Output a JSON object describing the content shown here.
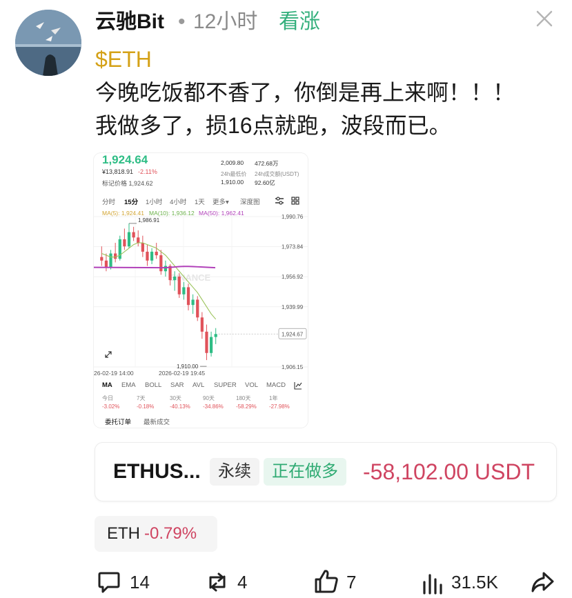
{
  "post": {
    "author": "云驰Bit",
    "dot": "•",
    "time": "12小时",
    "sentiment": "看涨",
    "tag": "$ETH",
    "text_line1": "今晚吃饭都不香了，你倒是再上来啊！！！",
    "text_line2": "我做多了，损16点就跑，波段而已。"
  },
  "chart_shot": {
    "price": "1,924.64",
    "sub_price": "¥13,818.91",
    "change": "-2.11%",
    "mark_label": "标记价格 1,924.62",
    "stat_top1": "2,009.80",
    "stat_top2": "472.68万",
    "stat_low_label": "24h最低价",
    "stat_vol_label": "24h成交额(USDT)",
    "stat_low": "1,910.00",
    "stat_vol": "92.60亿",
    "intervals": [
      "分时",
      "15分",
      "1小时",
      "4小时",
      "1天",
      "更多▾",
      "深度图"
    ],
    "ma_row": [
      "MA(5): 1,924.41",
      "MA(10): 1,936.12",
      "MA(50): 1,962.41"
    ],
    "y_ticks": [
      "1,990.76",
      "1,973.84",
      "1,956.92",
      "1,939.99",
      "1,924.67",
      "1,906.15"
    ],
    "high_label": "1,986.91",
    "low_label": "1,910.00",
    "x_ticks": [
      "26-02-19 14:00",
      "2026-02-19 19:45"
    ],
    "watermark": "BINANCE",
    "indicators": [
      "MA",
      "EMA",
      "BOLL",
      "SAR",
      "AVL",
      "SUPER",
      "VOL",
      "MACD"
    ],
    "periods": [
      {
        "label": "今日",
        "value": "-3.02%"
      },
      {
        "label": "7天",
        "value": "-0.18%"
      },
      {
        "label": "30天",
        "value": "-40.13%"
      },
      {
        "label": "90天",
        "value": "-34.86%"
      },
      {
        "label": "180天",
        "value": "-58.29%"
      },
      {
        "label": "1年",
        "value": "-27.98%"
      }
    ],
    "tabs": [
      "委托订单",
      "最新成交"
    ]
  },
  "chart_data": {
    "type": "candlestick",
    "ylim": [
      1906.15,
      1990.76
    ],
    "y_ticks": [
      1990.76,
      1973.84,
      1956.92,
      1939.99,
      1906.15
    ],
    "current_price": 1924.67,
    "high": 1986.91,
    "low": 1910.0,
    "candles": [
      {
        "o": 1968,
        "h": 1974,
        "l": 1963,
        "c": 1966
      },
      {
        "o": 1966,
        "h": 1970,
        "l": 1960,
        "c": 1962
      },
      {
        "o": 1962,
        "h": 1972,
        "l": 1961,
        "c": 1970
      },
      {
        "o": 1970,
        "h": 1976,
        "l": 1965,
        "c": 1967
      },
      {
        "o": 1967,
        "h": 1980,
        "l": 1966,
        "c": 1978
      },
      {
        "o": 1978,
        "h": 1984,
        "l": 1972,
        "c": 1974
      },
      {
        "o": 1974,
        "h": 1986.91,
        "l": 1973,
        "c": 1982
      },
      {
        "o": 1982,
        "h": 1985,
        "l": 1977,
        "c": 1979
      },
      {
        "o": 1979,
        "h": 1983,
        "l": 1974,
        "c": 1976
      },
      {
        "o": 1976,
        "h": 1980,
        "l": 1968,
        "c": 1971
      },
      {
        "o": 1971,
        "h": 1975,
        "l": 1963,
        "c": 1966
      },
      {
        "o": 1966,
        "h": 1973,
        "l": 1964,
        "c": 1971
      },
      {
        "o": 1971,
        "h": 1976,
        "l": 1967,
        "c": 1969
      },
      {
        "o": 1969,
        "h": 1972,
        "l": 1958,
        "c": 1960
      },
      {
        "o": 1960,
        "h": 1966,
        "l": 1957,
        "c": 1963
      },
      {
        "o": 1963,
        "h": 1964,
        "l": 1952,
        "c": 1955
      },
      {
        "o": 1955,
        "h": 1960,
        "l": 1949,
        "c": 1957
      },
      {
        "o": 1957,
        "h": 1959,
        "l": 1945,
        "c": 1947
      },
      {
        "o": 1947,
        "h": 1954,
        "l": 1944,
        "c": 1951
      },
      {
        "o": 1951,
        "h": 1953,
        "l": 1938,
        "c": 1941
      },
      {
        "o": 1941,
        "h": 1947,
        "l": 1936,
        "c": 1944
      },
      {
        "o": 1944,
        "h": 1946,
        "l": 1932,
        "c": 1934
      },
      {
        "o": 1934,
        "h": 1937,
        "l": 1922,
        "c": 1926
      },
      {
        "o": 1926,
        "h": 1930,
        "l": 1910.0,
        "c": 1914
      },
      {
        "o": 1914,
        "h": 1926,
        "l": 1912,
        "c": 1923
      },
      {
        "o": 1923,
        "h": 1928,
        "l": 1919,
        "c": 1924.67
      }
    ],
    "ma_series": [
      {
        "name": "MA(10)",
        "color": "#9bc35b",
        "values": [
          1970,
          1969,
          1968,
          1968,
          1969,
          1971,
          1973,
          1975,
          1976,
          1976,
          1975,
          1974,
          1973,
          1971,
          1969,
          1966,
          1963,
          1960,
          1957,
          1954,
          1951,
          1948,
          1944,
          1940,
          1936,
          1933
        ]
      },
      {
        "name": "MA(50)",
        "color": "#b140b9",
        "values": [
          null,
          null,
          null,
          null,
          null,
          null,
          null,
          null,
          null,
          null,
          null,
          null,
          null,
          null,
          1962,
          1962.2,
          1962.4,
          1962.6,
          1962.7,
          1962.7,
          1962.6,
          1962.5,
          1962.4,
          null,
          null,
          null
        ]
      }
    ],
    "up_color": "#2ebd85",
    "down_color": "#e0525a"
  },
  "position": {
    "symbol": "ETHUS...",
    "type": "永续",
    "side": "正在做多",
    "pnl": "-58,102.00 USDT"
  },
  "coin_chip": {
    "symbol": "ETH",
    "change": "-0.79%"
  },
  "actions": {
    "comments": "14",
    "reposts": "4",
    "likes": "7",
    "views": "31.5K"
  },
  "colors": {
    "bull": "#35b07d",
    "bear": "#cf4461",
    "tag": "#d4a117"
  }
}
